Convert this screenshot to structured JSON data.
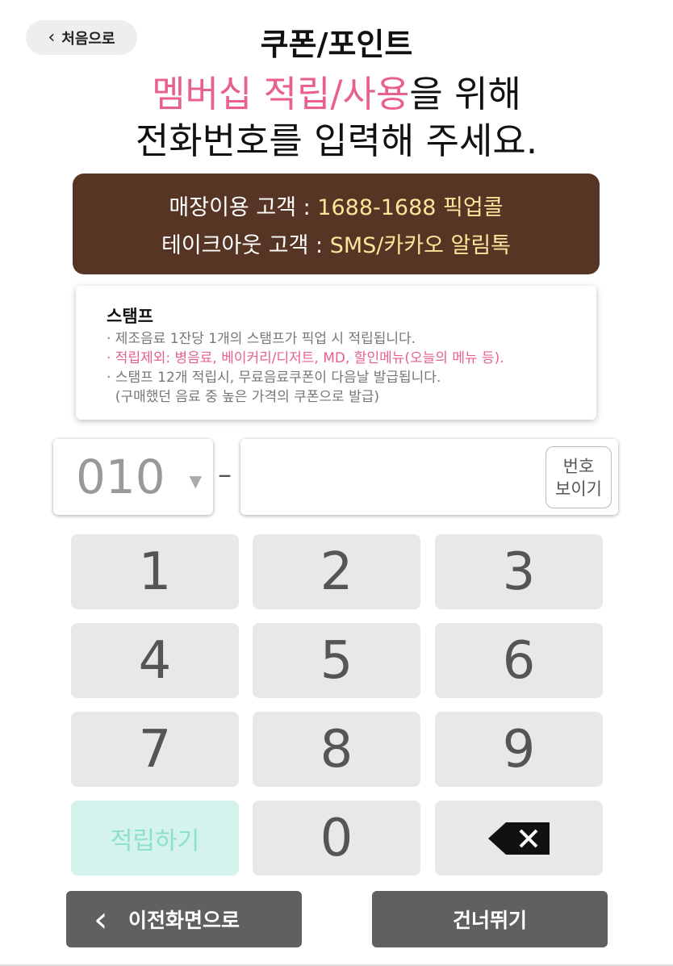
{
  "header": {
    "back_home_label": "처음으로",
    "title": "쿠폰/포인트"
  },
  "headline": {
    "accent": "멤버십 적립/사용",
    "line1_rest": "을 위해",
    "line2": "전화번호를 입력해 주세요."
  },
  "info": {
    "store_label": "매장이용 고객 : ",
    "store_value": "1688-1688 픽업콜",
    "takeout_label": "테이크아웃 고객 : ",
    "takeout_value": "SMS/카카오 알림톡"
  },
  "stamp": {
    "title": "스탬프",
    "lines": [
      "· 제조음료 1잔당 1개의 스탬프가 픽업 시 적립됩니다.",
      "· 적립제외: 병음료, 베이커리/디저트, MD, 할인메뉴(오늘의 메뉴 등).",
      "· 스탬프 12개 적립시, 무료음료쿠폰이 다음날 발급됩니다.",
      "  (구매했던 음료 중 높은 가격의 쿠폰으로 발급)"
    ]
  },
  "phone": {
    "prefix": "010",
    "separator": "–",
    "value": "",
    "show_label_1": "번호",
    "show_label_2": "보이기"
  },
  "keypad": {
    "keys": [
      "1",
      "2",
      "3",
      "4",
      "5",
      "6",
      "7",
      "8",
      "9"
    ],
    "accumulate_label": "적립하기",
    "zero": "0"
  },
  "footer": {
    "back_label": "이전화면으로",
    "skip_label": "건너뛰기"
  },
  "colors": {
    "accent_pink": "#e8608e",
    "info_bg": "#573525",
    "info_highlight": "#f8e79b",
    "key_bg": "#e8e8e8",
    "accumulate_bg": "#d3f3ec",
    "footer_btn": "#606060"
  },
  "icons": {
    "back_home": "chevron-left-icon",
    "prefix_caret": "caret-down-icon",
    "backspace": "backspace-icon",
    "back_footer": "chevron-left-icon"
  }
}
